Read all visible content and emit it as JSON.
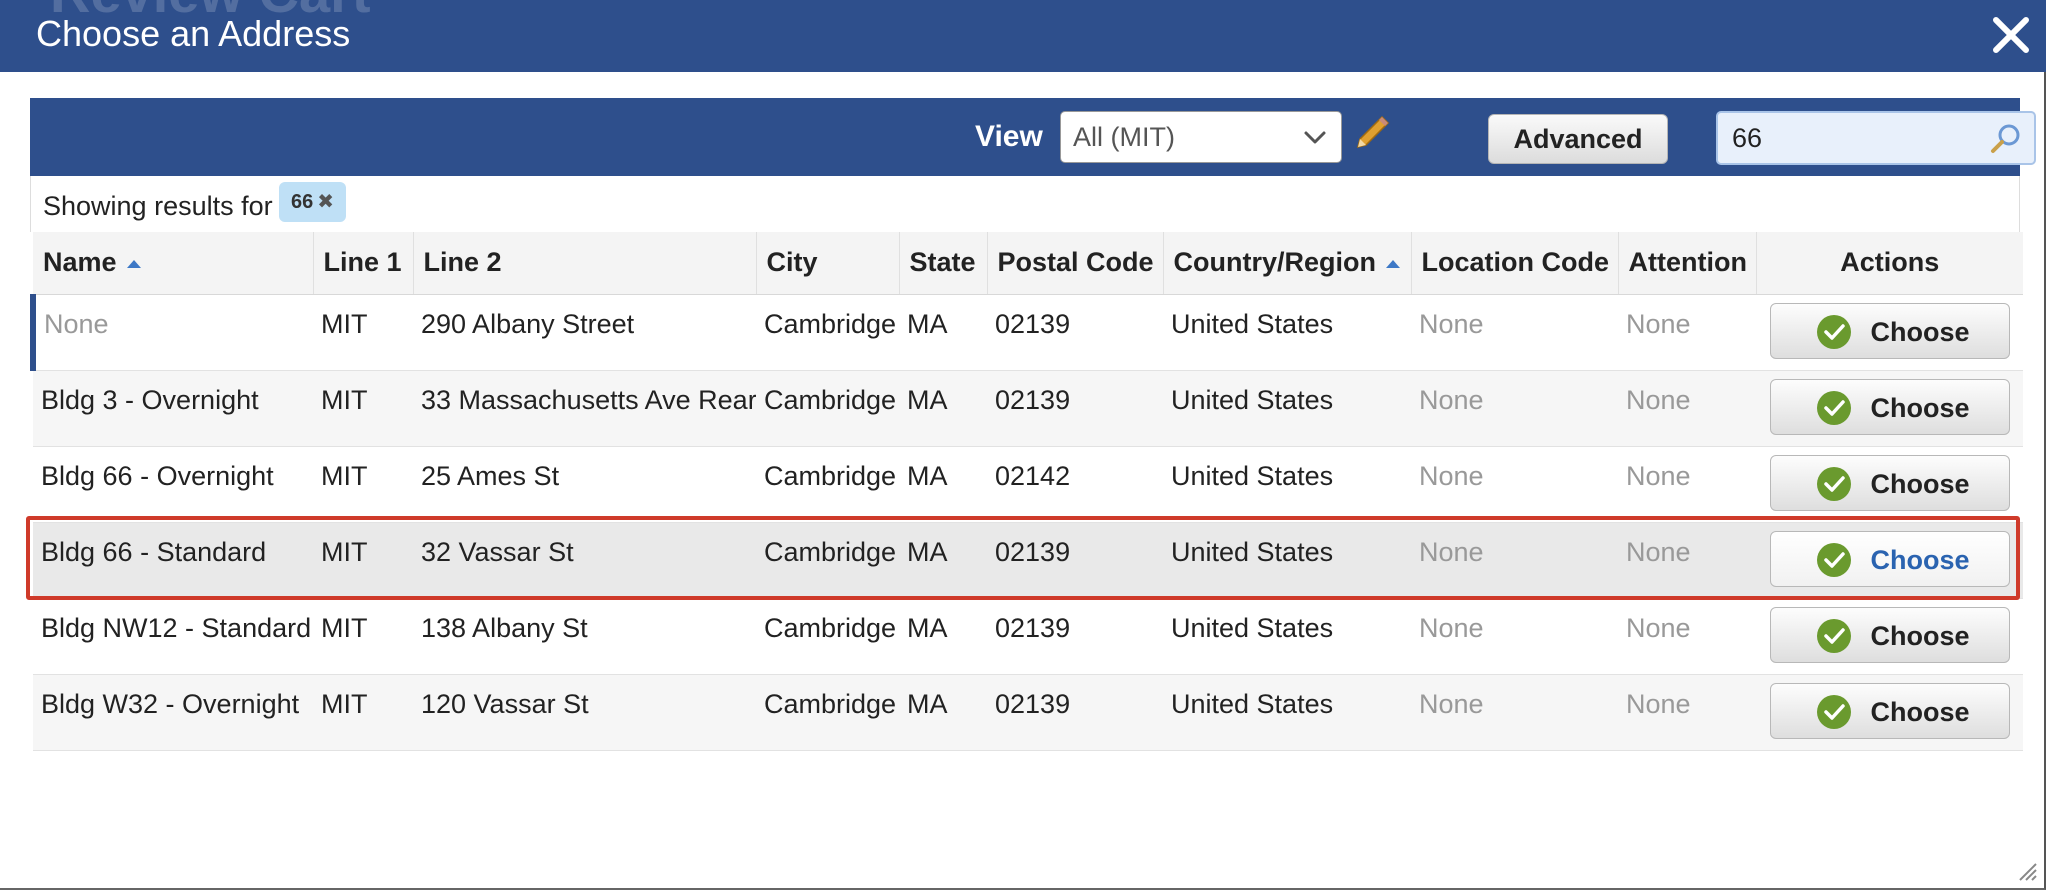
{
  "background_title": "Review Cart",
  "dialog": {
    "title": "Choose an Address"
  },
  "toolbar": {
    "view_label": "View",
    "view_selected": "All (MIT)",
    "advanced_label": "Advanced",
    "search_value": "66"
  },
  "results": {
    "label": "Showing results for",
    "chip": "66"
  },
  "table": {
    "columns": [
      "Name",
      "Line 1",
      "Line 2",
      "City",
      "State",
      "Postal Code",
      "Country/Region",
      "Location Code",
      "Attention",
      "Actions"
    ],
    "rows": [
      {
        "name": "None",
        "line1": "MIT",
        "line2": "290 Albany Street",
        "city": "Cambridge",
        "state": "MA",
        "postal": "02139",
        "country": "United States",
        "location": "None",
        "attention": "None",
        "action": "Choose"
      },
      {
        "name": "Bldg 3 - Overnight",
        "line1": "MIT",
        "line2": "33 Massachusetts Ave Rear",
        "city": "Cambridge",
        "state": "MA",
        "postal": "02139",
        "country": "United States",
        "location": "None",
        "attention": "None",
        "action": "Choose"
      },
      {
        "name": "Bldg 66 - Overnight",
        "line1": "MIT",
        "line2": "25 Ames St",
        "city": "Cambridge",
        "state": "MA",
        "postal": "02142",
        "country": "United States",
        "location": "None",
        "attention": "None",
        "action": "Choose"
      },
      {
        "name": "Bldg 66 - Standard",
        "line1": "MIT",
        "line2": "32 Vassar St",
        "city": "Cambridge",
        "state": "MA",
        "postal": "02139",
        "country": "United States",
        "location": "None",
        "attention": "None",
        "action": "Choose"
      },
      {
        "name": "Bldg NW12 - Standard",
        "line1": "MIT",
        "line2": "138 Albany St",
        "city": "Cambridge",
        "state": "MA",
        "postal": "02139",
        "country": "United States",
        "location": "None",
        "attention": "None",
        "action": "Choose"
      },
      {
        "name": "Bldg W32 - Overnight",
        "line1": "MIT",
        "line2": "120 Vassar St",
        "city": "Cambridge",
        "state": "MA",
        "postal": "02139",
        "country": "United States",
        "location": "None",
        "attention": "None",
        "action": "Choose"
      }
    ]
  },
  "colors": {
    "header_blue": "#2e4f8c",
    "highlight_red": "#cf3a2a",
    "check_green": "#6a9a2e",
    "sort_arrow": "#3d78c6"
  }
}
